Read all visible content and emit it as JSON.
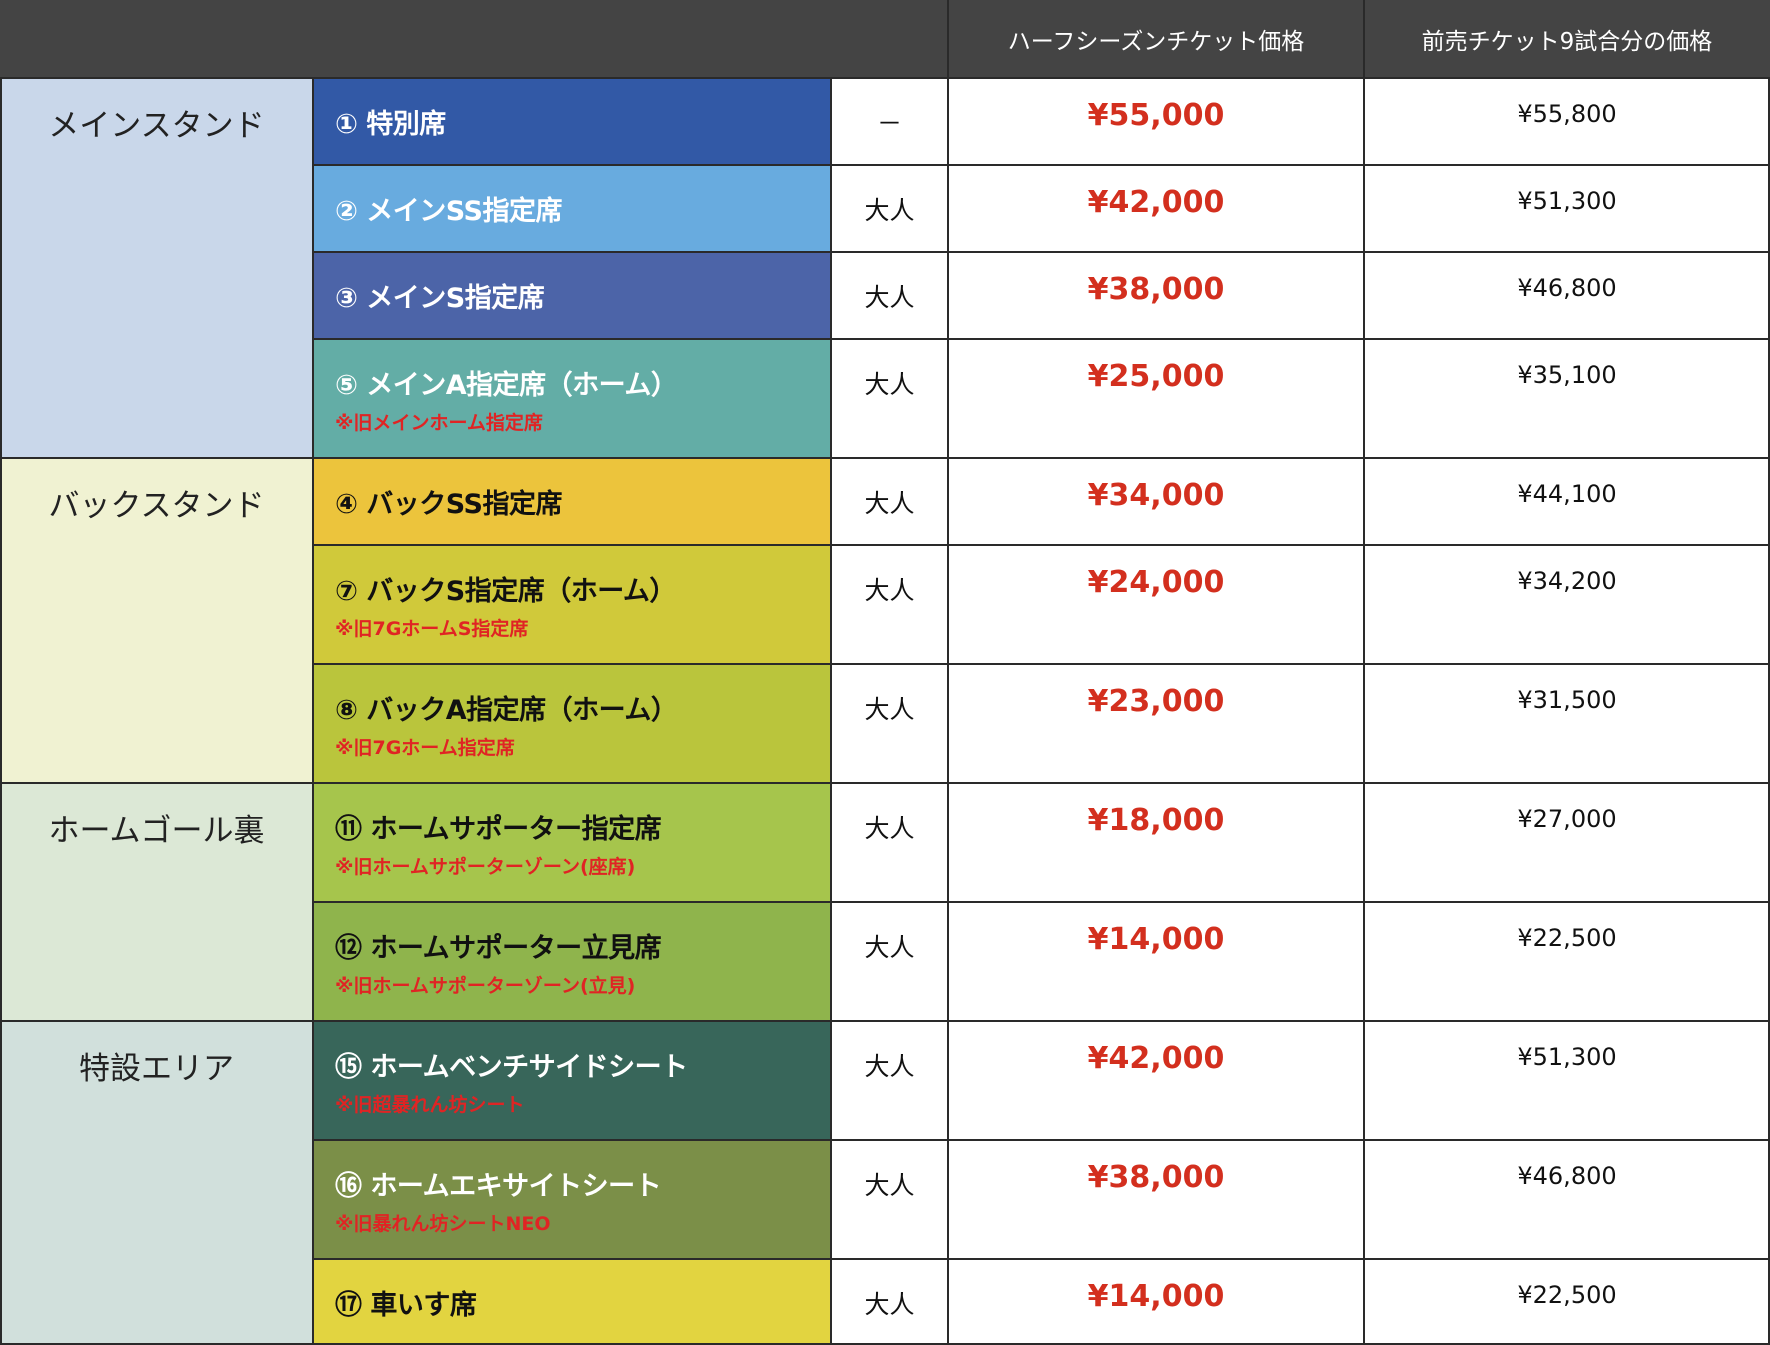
{
  "header": {
    "half_season": "ハーフシーズンチケット価格",
    "advance_9": "前売チケット9試合分の価格"
  },
  "categories": [
    {
      "label": "メインスタンド",
      "color": "#c9d7ea",
      "rows": 4
    },
    {
      "label": "バックスタンド",
      "color": "#f0f2d2",
      "rows": 3
    },
    {
      "label": "ホームゴール裏",
      "color": "#dce8d6",
      "rows": 2
    },
    {
      "label": "特設エリア",
      "color": "#d1e0dc",
      "rows": 3
    }
  ],
  "rows": [
    {
      "seat": "① 特別席",
      "note": "",
      "age": "－",
      "half": "¥55,000",
      "advance": "¥55,800",
      "color": "#3259a6",
      "text": "light"
    },
    {
      "seat": "② メインSS指定席",
      "note": "",
      "age": "大人",
      "half": "¥42,000",
      "advance": "¥51,300",
      "color": "#68abdf",
      "text": "light"
    },
    {
      "seat": "③ メインS指定席",
      "note": "",
      "age": "大人",
      "half": "¥38,000",
      "advance": "¥46,800",
      "color": "#4c64a8",
      "text": "light"
    },
    {
      "seat": "⑤ メインA指定席（ホーム）",
      "note": "※旧メインホーム指定席",
      "age": "大人",
      "half": "¥25,000",
      "advance": "¥35,100",
      "color": "#63ada6",
      "text": "light"
    },
    {
      "seat": "④ バックSS指定席",
      "note": "",
      "age": "大人",
      "half": "¥34,000",
      "advance": "¥44,100",
      "color": "#ecc43c",
      "text": "dark"
    },
    {
      "seat": "⑦ バックS指定席（ホーム）",
      "note": "※旧7GホームS指定席",
      "age": "大人",
      "half": "¥24,000",
      "advance": "¥34,200",
      "color": "#d0c93a",
      "text": "dark"
    },
    {
      "seat": "⑧ バックA指定席（ホーム）",
      "note": "※旧7Gホーム指定席",
      "age": "大人",
      "half": "¥23,000",
      "advance": "¥31,500",
      "color": "#bac53c",
      "text": "dark"
    },
    {
      "seat": "⑪ ホームサポーター指定席",
      "note": "※旧ホームサポーターゾーン(座席)",
      "age": "大人",
      "half": "¥18,000",
      "advance": "¥27,000",
      "color": "#a6c54c",
      "text": "dark"
    },
    {
      "seat": "⑫ ホームサポーター立見席",
      "note": "※旧ホームサポーターゾーン(立見)",
      "age": "大人",
      "half": "¥14,000",
      "advance": "¥22,500",
      "color": "#8fb44c",
      "text": "dark"
    },
    {
      "seat": "⑮ ホームベンチサイドシート",
      "note": "※旧超暴れん坊シート",
      "age": "大人",
      "half": "¥42,000",
      "advance": "¥51,300",
      "color": "#38665a",
      "text": "light"
    },
    {
      "seat": "⑯ ホームエキサイトシート",
      "note": "※旧暴れん坊シートNEO",
      "age": "大人",
      "half": "¥38,000",
      "advance": "¥46,800",
      "color": "#7b8f48",
      "text": "light"
    },
    {
      "seat": "⑰ 車いす席",
      "note": "",
      "age": "大人",
      "half": "¥14,000",
      "advance": "¥22,500",
      "color": "#e2d440",
      "text": "dark"
    }
  ]
}
